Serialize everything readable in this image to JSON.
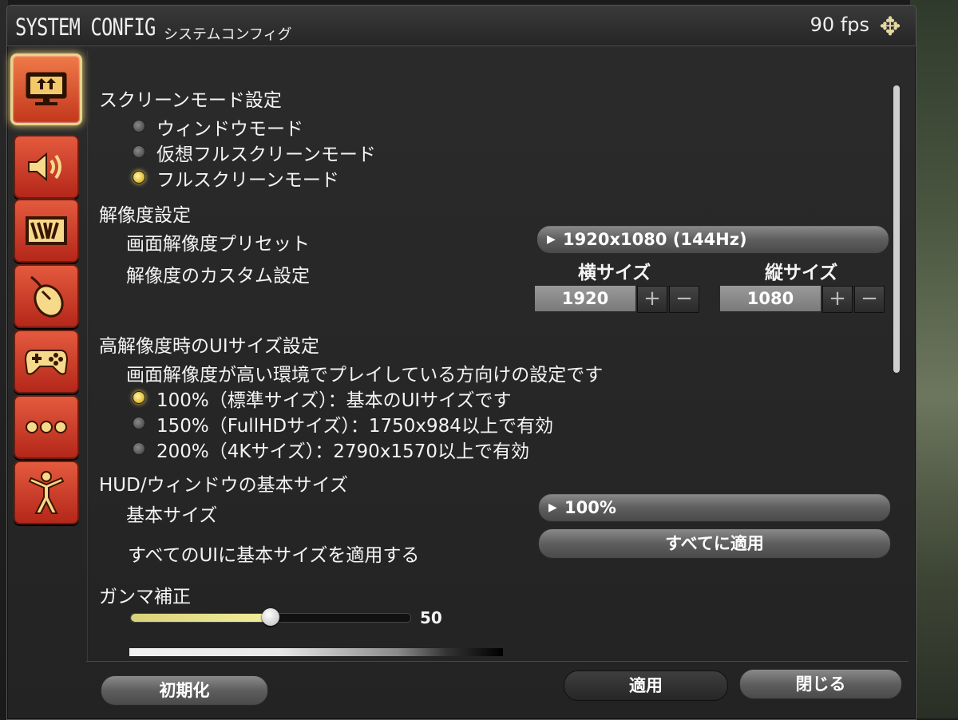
{
  "title": {
    "en": "SYSTEM CONFIG",
    "jp": "システムコンフィグ"
  },
  "fps": "90 fps",
  "sidebar": {
    "items": [
      {
        "name": "display-settings",
        "icon": "monitor-icon",
        "active": true
      },
      {
        "name": "sound-settings",
        "icon": "speaker-icon"
      },
      {
        "name": "graphics-settings",
        "icon": "graphics-icon"
      },
      {
        "name": "mouse-settings",
        "icon": "mouse-icon"
      },
      {
        "name": "gamepad-settings",
        "icon": "gamepad-icon"
      },
      {
        "name": "other-settings",
        "icon": "more-icon"
      },
      {
        "name": "character-settings",
        "icon": "person-icon"
      }
    ]
  },
  "screen_mode": {
    "heading": "スクリーンモード設定",
    "options": [
      "ウィンドウモード",
      "仮想フルスクリーンモード",
      "フルスクリーンモード"
    ],
    "selected_index": 2
  },
  "resolution": {
    "heading": "解像度設定",
    "preset_label": "画面解像度プリセット",
    "preset_value": "1920x1080 (144Hz)",
    "custom_label": "解像度のカスタム設定",
    "width_label": "横サイズ",
    "height_label": "縦サイズ",
    "width_value": "1920",
    "height_value": "1080",
    "plus": "+",
    "minus": "−"
  },
  "ui_size": {
    "heading": "高解像度時のUIサイズ設定",
    "description": "画面解像度が高い環境でプレイしている方向けの設定です",
    "options": [
      "100%（標準サイズ）：基本のUIサイズです",
      "150%（FullHDサイズ）：1750x984以上で有効",
      "200%（4Kサイズ）：2790x1570以上で有効"
    ],
    "selected_index": 0
  },
  "hud": {
    "heading": "HUD/ウィンドウの基本サイズ",
    "base_label": "基本サイズ",
    "base_value": "100%",
    "apply_all_label": "すべてのUIに基本サイズを適用する",
    "apply_all_button": "すべてに適用"
  },
  "gamma": {
    "heading": "ガンマ補正",
    "value": 50,
    "value_text": "50",
    "max": 100
  },
  "footer": {
    "reset": "初期化",
    "apply": "適用",
    "close": "閉じる"
  },
  "colors": {
    "accent_gold": "#e6c23a",
    "sidebar_red": "#c2371d",
    "active_glow": "#f3d37a"
  }
}
